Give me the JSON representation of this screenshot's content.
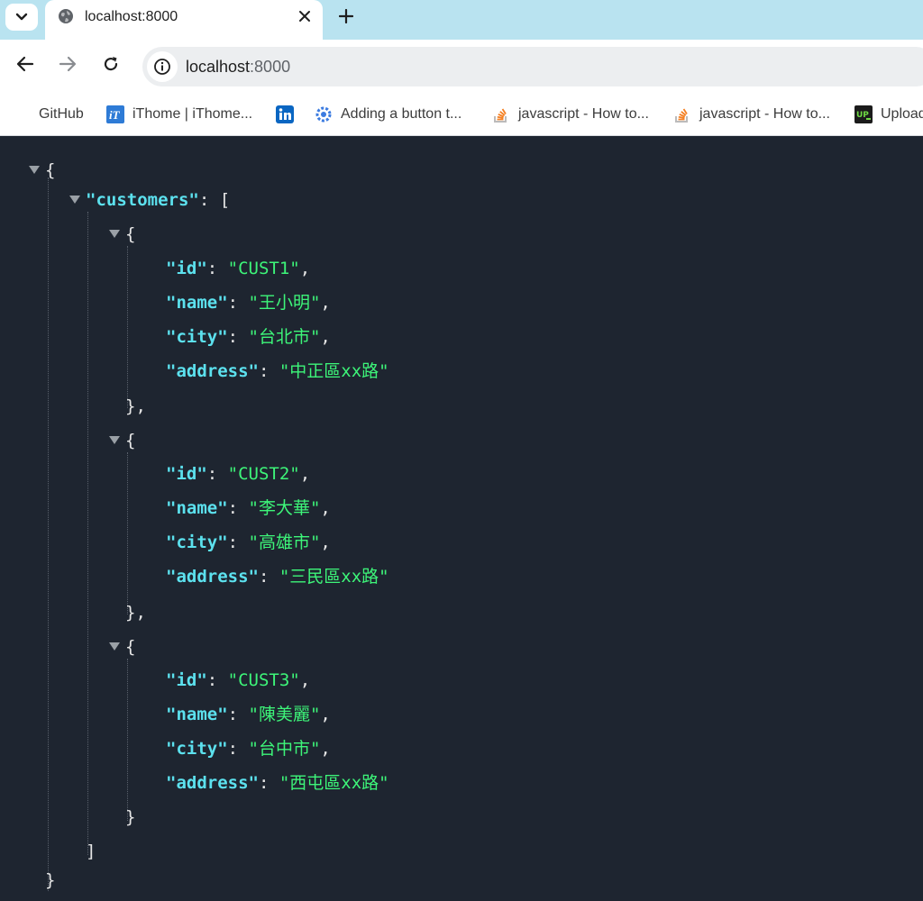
{
  "browser": {
    "tab_title": "localhost:8000",
    "url_host": "localhost",
    "url_port": ":8000",
    "bookmarks": [
      {
        "label": "GitHub",
        "icon": "github-icon"
      },
      {
        "label": "iThome | iThome...",
        "icon": "ithome-icon"
      },
      {
        "label": "",
        "icon": "linkedin-icon"
      },
      {
        "label": "Adding a button t...",
        "icon": "gear-blue-icon"
      },
      {
        "label": "javascript - How to...",
        "icon": "stackoverflow-icon"
      },
      {
        "label": "javascript - How to...",
        "icon": "stackoverflow-icon"
      },
      {
        "label": "Upload",
        "icon": "upwork-icon"
      }
    ]
  },
  "json": {
    "root_key": "\"customers\"",
    "customers": [
      {
        "id": "\"CUST1\"",
        "name": "\"王小明\"",
        "city": "\"台北市\"",
        "address": "\"中正區xx路\""
      },
      {
        "id": "\"CUST2\"",
        "name": "\"李大華\"",
        "city": "\"高雄市\"",
        "address": "\"三民區xx路\""
      },
      {
        "id": "\"CUST3\"",
        "name": "\"陳美麗\"",
        "city": "\"台中市\"",
        "address": "\"西屯區xx路\""
      }
    ],
    "labels": {
      "id": "\"id\"",
      "name": "\"name\"",
      "city": "\"city\"",
      "address": "\"address\""
    }
  },
  "colors": {
    "key": "#5ce1ee",
    "string": "#3df579",
    "background": "#1e2530",
    "tabstrip": "#b9e3f0"
  }
}
